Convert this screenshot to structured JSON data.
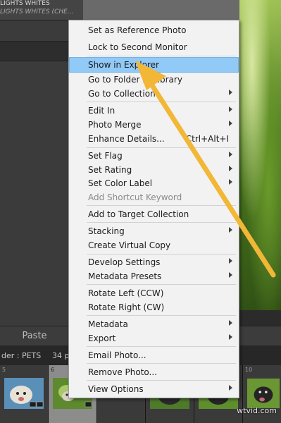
{
  "left_panel": {
    "header_line1": "LIGHTS WHITES",
    "header_line2": "LIGHTS WHITES (CHE..."
  },
  "toolbar": {
    "paste_label": "Paste"
  },
  "filmstrip_bar": {
    "folder_label": "der : PETS",
    "count_label": "34 p"
  },
  "filmstrip": {
    "cells": [
      {
        "number": "5"
      },
      {
        "number": "6"
      },
      {
        "number": ""
      },
      {
        "number": ""
      },
      {
        "number": ""
      },
      {
        "number": "10"
      }
    ]
  },
  "context_menu": {
    "items": [
      {
        "label": "Set as Reference Photo",
        "shortcut": "",
        "submenu": false,
        "disabled": false
      },
      {
        "label": "Lock to Second Monitor",
        "shortcut": "",
        "submenu": false,
        "disabled": false
      },
      {
        "label": "Show in Explorer",
        "shortcut": "",
        "submenu": false,
        "disabled": false,
        "highlighted": true
      },
      {
        "label": "Go to Folder in Library",
        "shortcut": "",
        "submenu": false,
        "disabled": false
      },
      {
        "label": "Go to Collection",
        "shortcut": "",
        "submenu": true,
        "disabled": false
      },
      {
        "label": "Edit In",
        "shortcut": "",
        "submenu": true,
        "disabled": false
      },
      {
        "label": "Photo Merge",
        "shortcut": "",
        "submenu": true,
        "disabled": false
      },
      {
        "label": "Enhance Details...",
        "shortcut": "Ctrl+Alt+I",
        "submenu": false,
        "disabled": false
      },
      {
        "label": "Set Flag",
        "shortcut": "",
        "submenu": true,
        "disabled": false
      },
      {
        "label": "Set Rating",
        "shortcut": "",
        "submenu": true,
        "disabled": false
      },
      {
        "label": "Set Color Label",
        "shortcut": "",
        "submenu": true,
        "disabled": false
      },
      {
        "label": "Add Shortcut Keyword",
        "shortcut": "",
        "submenu": false,
        "disabled": true
      },
      {
        "label": "Add to Target Collection",
        "shortcut": "",
        "submenu": false,
        "disabled": false
      },
      {
        "label": "Stacking",
        "shortcut": "",
        "submenu": true,
        "disabled": false
      },
      {
        "label": "Create Virtual Copy",
        "shortcut": "",
        "submenu": false,
        "disabled": false
      },
      {
        "label": "Develop Settings",
        "shortcut": "",
        "submenu": true,
        "disabled": false
      },
      {
        "label": "Metadata Presets",
        "shortcut": "",
        "submenu": true,
        "disabled": false
      },
      {
        "label": "Rotate Left (CCW)",
        "shortcut": "",
        "submenu": false,
        "disabled": false
      },
      {
        "label": "Rotate Right (CW)",
        "shortcut": "",
        "submenu": false,
        "disabled": false
      },
      {
        "label": "Metadata",
        "shortcut": "",
        "submenu": true,
        "disabled": false
      },
      {
        "label": "Export",
        "shortcut": "",
        "submenu": true,
        "disabled": false
      },
      {
        "label": "Email Photo...",
        "shortcut": "",
        "submenu": false,
        "disabled": false
      },
      {
        "label": "Remove Photo...",
        "shortcut": "",
        "submenu": false,
        "disabled": false
      },
      {
        "label": "View Options",
        "shortcut": "",
        "submenu": true,
        "disabled": false
      }
    ]
  },
  "colors": {
    "highlight": "#91c9f7",
    "annotation_arrow": "#f2b736",
    "menu_background": "#f2f2f2"
  },
  "annotation": {
    "icon": "arrow-pointer-icon"
  },
  "watermark": "wtvid.com"
}
